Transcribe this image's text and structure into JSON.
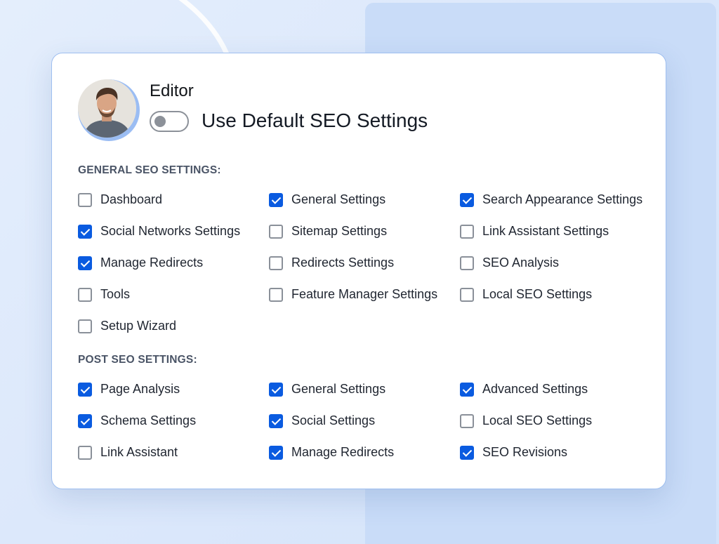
{
  "profile": {
    "role": "Editor",
    "toggle_label": "Use Default SEO Settings",
    "toggle_on": false
  },
  "general": {
    "title": "GENERAL SEO SETTINGS:",
    "items": [
      {
        "label": "Dashboard",
        "checked": false
      },
      {
        "label": "General Settings",
        "checked": true
      },
      {
        "label": "Search Appearance Settings",
        "checked": true
      },
      {
        "label": "Social Networks Settings",
        "checked": true
      },
      {
        "label": "Sitemap Settings",
        "checked": false
      },
      {
        "label": "Link Assistant Settings",
        "checked": false
      },
      {
        "label": "Manage Redirects",
        "checked": true
      },
      {
        "label": "Redirects Settings",
        "checked": false
      },
      {
        "label": "SEO Analysis",
        "checked": false
      },
      {
        "label": "Tools",
        "checked": false
      },
      {
        "label": "Feature Manager Settings",
        "checked": false
      },
      {
        "label": "Local SEO Settings",
        "checked": false
      },
      {
        "label": "Setup Wizard",
        "checked": false
      }
    ]
  },
  "post": {
    "title": "POST SEO SETTINGS:",
    "items": [
      {
        "label": "Page Analysis",
        "checked": true
      },
      {
        "label": "General Settings",
        "checked": true
      },
      {
        "label": "Advanced Settings",
        "checked": true
      },
      {
        "label": "Schema Settings",
        "checked": true
      },
      {
        "label": "Social Settings",
        "checked": true
      },
      {
        "label": "Local SEO Settings",
        "checked": false
      },
      {
        "label": "Link Assistant",
        "checked": false
      },
      {
        "label": "Manage Redirects",
        "checked": true
      },
      {
        "label": "SEO Revisions",
        "checked": true
      }
    ]
  },
  "colors": {
    "accent": "#0a5be0",
    "card_border": "#9fbff0"
  }
}
